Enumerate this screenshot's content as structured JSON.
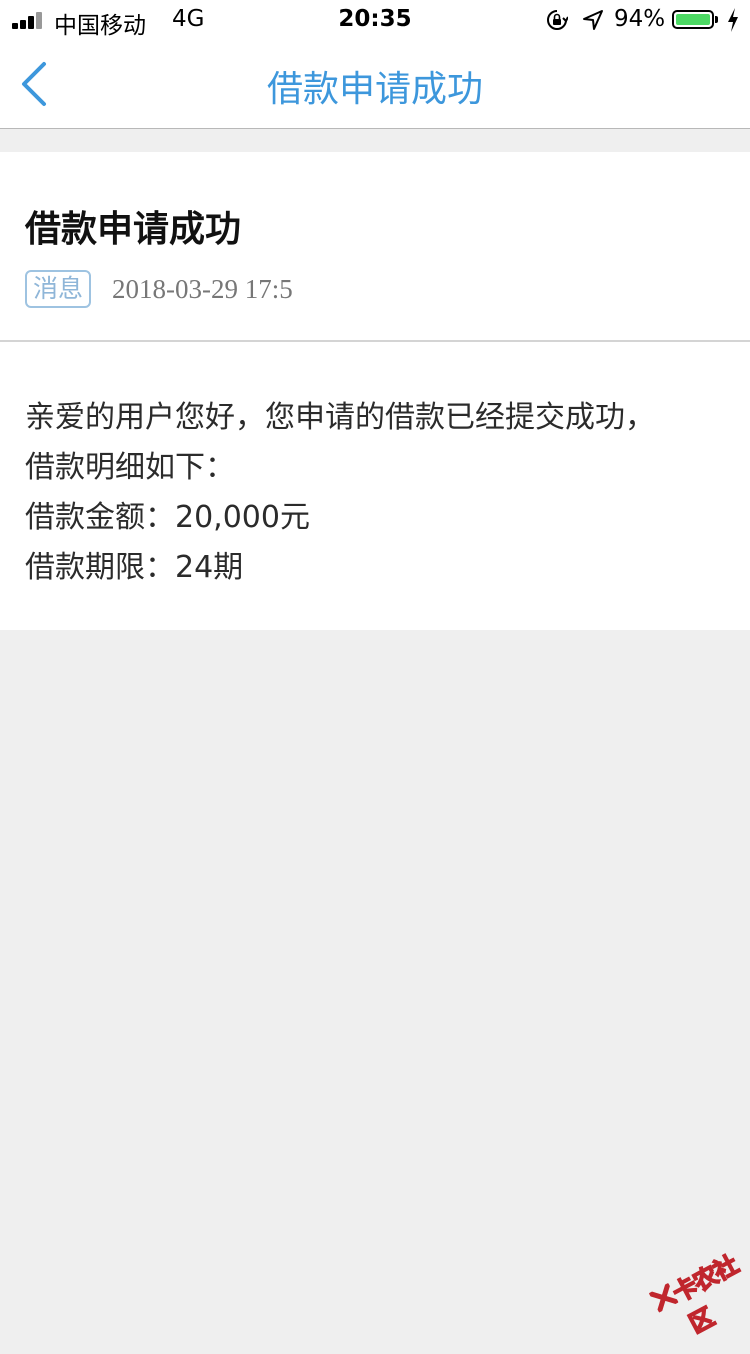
{
  "status_bar": {
    "carrier": "中国移动",
    "network": "4G",
    "time": "20:35",
    "battery_percent": "94%",
    "battery_level": 0.94,
    "battery_color": "#4cd964",
    "icons": [
      "signal-icon",
      "orientation-lock-icon",
      "location-icon",
      "battery-icon",
      "charging-icon"
    ]
  },
  "nav": {
    "title": "借款申请成功",
    "back_icon": "chevron-left-icon",
    "accent_color": "#3d97dc"
  },
  "message": {
    "title": "借款申请成功",
    "tag": "消息",
    "datetime": "2018-03-29 17:5",
    "body_lines": [
      "亲爱的用户您好，您申请的借款已经提交成功，",
      "借款明细如下：",
      "借款金额：20,000元",
      "借款期限：24期"
    ]
  },
  "watermark": {
    "text": "卡农社区"
  }
}
